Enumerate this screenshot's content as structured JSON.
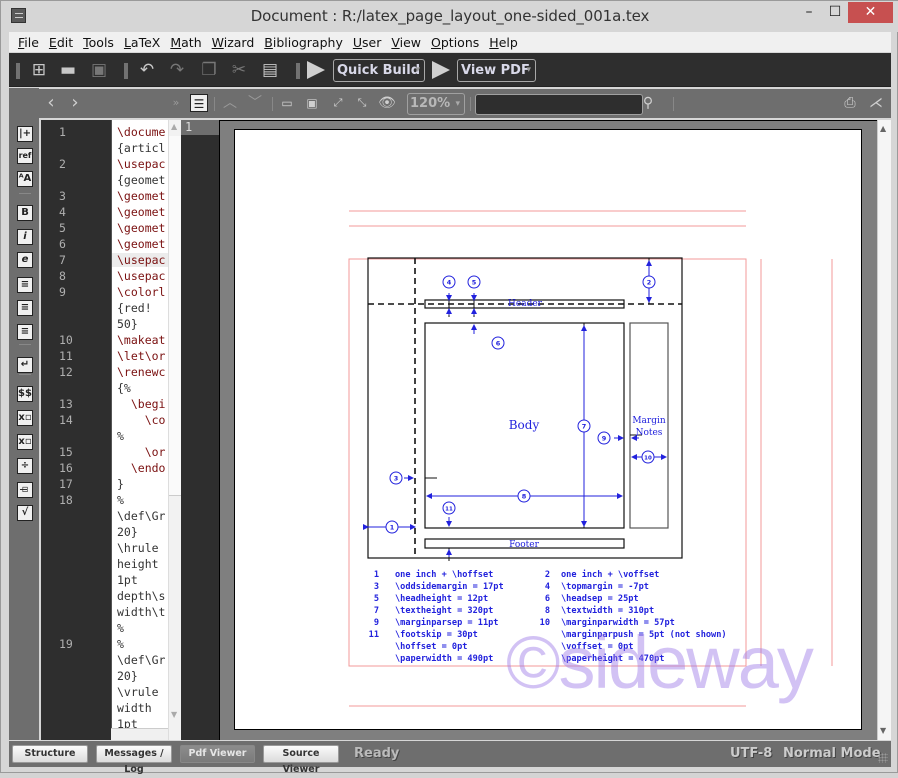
{
  "window": {
    "title": "Document : R:/latex_page_layout_one-sided_001a.tex",
    "controls": {
      "minimize": "–",
      "maximize": "☐",
      "close": "✕"
    }
  },
  "menu": [
    {
      "label": "File",
      "accel": "F",
      "rest": "ile"
    },
    {
      "label": "Edit",
      "accel": "E",
      "rest": "dit"
    },
    {
      "label": "Tools",
      "accel": "T",
      "rest": "ools"
    },
    {
      "label": "LaTeX",
      "accel": "L",
      "rest": "aTeX"
    },
    {
      "label": "Math",
      "accel": "M",
      "rest": "ath"
    },
    {
      "label": "Wizard",
      "accel": "W",
      "rest": "izard"
    },
    {
      "label": "Bibliography",
      "accel": "B",
      "rest": "ibliography"
    },
    {
      "label": "User",
      "accel": "U",
      "rest": "ser"
    },
    {
      "label": "View",
      "accel": "V",
      "rest": "iew"
    },
    {
      "label": "Options",
      "accel": "O",
      "rest": "ptions"
    },
    {
      "label": "Help",
      "accel": "H",
      "rest": "elp"
    }
  ],
  "toolbar": {
    "icons": {
      "new": "new-file-icon",
      "open": "open-folder-icon",
      "save": "save-icon",
      "undo": "undo-icon",
      "redo": "redo-icon",
      "copy": "copy-icon",
      "cut": "cut-icon",
      "paste": "paste-icon"
    },
    "glyphs": {
      "new": "⊞",
      "open": "▬",
      "save": "▣",
      "undo": "↶",
      "redo": "↷",
      "copy": "❐",
      "cut": "✂",
      "paste": "▤"
    },
    "build_combo": "Quick Build",
    "view_combo": "View PDF",
    "dropdown_arrow": "▾"
  },
  "side_panel": {
    "icons": [
      {
        "name": "include-icon",
        "glyph": "|+"
      },
      {
        "name": "ref-icon",
        "glyph": "ref"
      },
      {
        "name": "font-size-icon",
        "glyph": "ᴬA"
      },
      {
        "name": "bold-icon",
        "glyph": "B"
      },
      {
        "name": "italic-icon",
        "glyph": "i"
      },
      {
        "name": "emphasis-icon",
        "glyph": "e"
      },
      {
        "name": "align-left-icon",
        "glyph": "≡"
      },
      {
        "name": "align-center-icon",
        "glyph": "≡"
      },
      {
        "name": "align-right-icon",
        "glyph": "≡"
      },
      {
        "name": "newline-icon",
        "glyph": "↵"
      },
      {
        "name": "math-mode-icon",
        "glyph": "$$"
      },
      {
        "name": "subscript-icon",
        "glyph": "x▫"
      },
      {
        "name": "superscript-icon",
        "glyph": "x▫"
      },
      {
        "name": "division-icon",
        "glyph": "÷"
      },
      {
        "name": "fraction-icon",
        "glyph": "▫̶"
      },
      {
        "name": "sqrt-icon",
        "glyph": "√"
      }
    ]
  },
  "editor": {
    "line_numbers": [
      {
        "n": "1",
        "row": 0
      },
      {
        "n": "2",
        "row": 2
      },
      {
        "n": "3",
        "row": 4
      },
      {
        "n": "4",
        "row": 5
      },
      {
        "n": "5",
        "row": 6
      },
      {
        "n": "6",
        "row": 7
      },
      {
        "n": "7",
        "row": 8
      },
      {
        "n": "8",
        "row": 9
      },
      {
        "n": "9",
        "row": 10
      },
      {
        "n": "10",
        "row": 13
      },
      {
        "n": "11",
        "row": 14
      },
      {
        "n": "12",
        "row": 15
      },
      {
        "n": "13",
        "row": 17
      },
      {
        "n": "14",
        "row": 18
      },
      {
        "n": "15",
        "row": 20
      },
      {
        "n": "16",
        "row": 21
      },
      {
        "n": "17",
        "row": 22
      },
      {
        "n": "18",
        "row": 23
      },
      {
        "n": "19",
        "row": 32
      }
    ],
    "lines": [
      {
        "text": "\\docume",
        "kw": true
      },
      {
        "text": "{articl",
        "kw": false
      },
      {
        "text": "\\usepac",
        "kw": true
      },
      {
        "text": "{geomet",
        "kw": false
      },
      {
        "text": "\\geomet",
        "kw": true
      },
      {
        "text": "\\geomet",
        "kw": true
      },
      {
        "text": "\\geomet",
        "kw": true
      },
      {
        "text": "\\geomet",
        "kw": true
      },
      {
        "text": "\\usepac",
        "kw": true,
        "current": true
      },
      {
        "text": "\\usepac",
        "kw": true
      },
      {
        "text": "\\colorl",
        "kw": true
      },
      {
        "text": "{red!",
        "kw": false
      },
      {
        "text": "50}",
        "kw": false
      },
      {
        "text": "\\makeat",
        "kw": true
      },
      {
        "text": "\\let\\or",
        "kw": true
      },
      {
        "text": "\\renewc",
        "kw": true
      },
      {
        "text": "{%",
        "kw": false
      },
      {
        "text": "  \\begi",
        "kw": true
      },
      {
        "text": "    \\co",
        "kw": true
      },
      {
        "text": "%",
        "kw": false
      },
      {
        "text": "    \\or",
        "kw": true
      },
      {
        "text": "  \\endo",
        "kw": true
      },
      {
        "text": "}",
        "kw": false
      },
      {
        "text": "%",
        "kw": false
      },
      {
        "text": "\\def\\Gr",
        "kw": false
      },
      {
        "text": "20}",
        "kw": false
      },
      {
        "text": "\\hrule",
        "kw": false
      },
      {
        "text": "height",
        "kw": false
      },
      {
        "text": "1pt",
        "kw": false
      },
      {
        "text": "depth\\s",
        "kw": false
      },
      {
        "text": "width\\t",
        "kw": false
      },
      {
        "text": "%",
        "kw": false
      },
      {
        "text": "%",
        "kw": false
      },
      {
        "text": "\\def\\Gr",
        "kw": false
      },
      {
        "text": "20}",
        "kw": false
      },
      {
        "text": "\\vrule",
        "kw": false
      },
      {
        "text": "width",
        "kw": false
      },
      {
        "text": "1pt",
        "kw": false
      }
    ]
  },
  "pdf_toolbar": {
    "icons": [
      "sync-icon",
      "back-icon",
      "forward-icon",
      "more-icon",
      "toc-icon",
      "prev-page-icon",
      "next-page-icon",
      "fit-width-icon",
      "fit-page-icon",
      "zoom-in-icon",
      "zoom-out-icon",
      "view-options-icon"
    ],
    "zoom_value": "120%",
    "search_value": "",
    "search_icon": "search-icon",
    "print_icon": "print-icon",
    "close_icon": "close-viewer-icon"
  },
  "pdf": {
    "page_number": "1",
    "diagram": {
      "header_label": "Header",
      "body_label": "Body",
      "footer_label": "Footer",
      "margin_label_1": "Margin",
      "margin_label_2": "Notes",
      "callouts": [
        "1",
        "2",
        "3",
        "4",
        "5",
        "6",
        "7",
        "8",
        "9",
        "10",
        "11"
      ]
    },
    "legend": [
      {
        "num": "1",
        "text": "one inch + \\hoffset",
        "num2": "2",
        "text2": "one inch + \\voffset"
      },
      {
        "num": "3",
        "text": "\\oddsidemargin = 17pt",
        "num2": "4",
        "text2": "\\topmargin = -7pt"
      },
      {
        "num": "5",
        "text": "\\headheight = 12pt",
        "num2": "6",
        "text2": "\\headsep = 25pt"
      },
      {
        "num": "7",
        "text": "\\textheight = 320pt",
        "num2": "8",
        "text2": "\\textwidth = 310pt"
      },
      {
        "num": "9",
        "text": "\\marginparsep = 11pt",
        "num2": "10",
        "text2": "\\marginparwidth = 57pt"
      },
      {
        "num": "11",
        "text": "\\footskip = 30pt",
        "num2": "",
        "text2": "\\marginparpush = 5pt (not shown)"
      },
      {
        "num": "",
        "text": "\\hoffset = 0pt",
        "num2": "",
        "text2": "\\voffset = 0pt"
      },
      {
        "num": "",
        "text": "\\paperwidth = 490pt",
        "num2": "",
        "text2": "\\paperheight = 470pt"
      }
    ],
    "watermark": "©sideway",
    "colors": {
      "diagram_blue": "#2222dd",
      "guide_red": "#f08080"
    }
  },
  "bottom": {
    "tabs": [
      {
        "label": "Structure",
        "active": false
      },
      {
        "label": "Messages / Log",
        "active": false
      },
      {
        "label": "Pdf Viewer",
        "active": true
      },
      {
        "label": "Source Viewer",
        "active": false
      }
    ],
    "status": "Ready",
    "encoding": "UTF-8",
    "mode": "Normal Mode"
  }
}
